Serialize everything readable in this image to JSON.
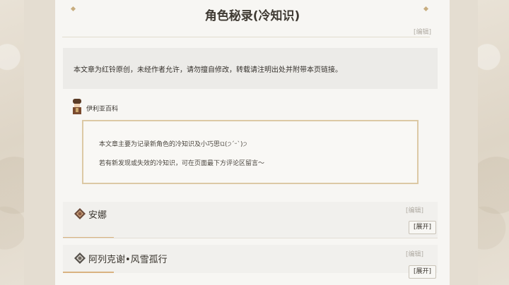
{
  "page": {
    "title": "角色秘录(冷知识)",
    "edit_label": "[编辑]"
  },
  "notice": {
    "text": "本文章为红铃原创，未经作者允许，请勿擅自修改，转载请注明出处并附带本页链接。"
  },
  "author": {
    "name": "伊利亚百科",
    "avatar_icon": "character-avatar-icon"
  },
  "quote": {
    "line1": "本文章主要为记录新角色的冷知识及小巧思ଘ(੭ˊᵕˋ)੭",
    "line2": "若有新发现或失效的冷知识，可在页面最下方评论区留言～"
  },
  "sections": [
    {
      "title": "安娜",
      "edit_label": "[编辑]",
      "expand_label": "[展开]",
      "icon": "character-emblem-icon"
    },
    {
      "title": "阿列克谢•风雪孤行",
      "edit_label": "[编辑]",
      "expand_label": "[展开]",
      "icon": "character-emblem-icon"
    }
  ],
  "colors": {
    "accent": "#d9b381",
    "frame": "#dcc9a5",
    "text": "#3a352e"
  }
}
